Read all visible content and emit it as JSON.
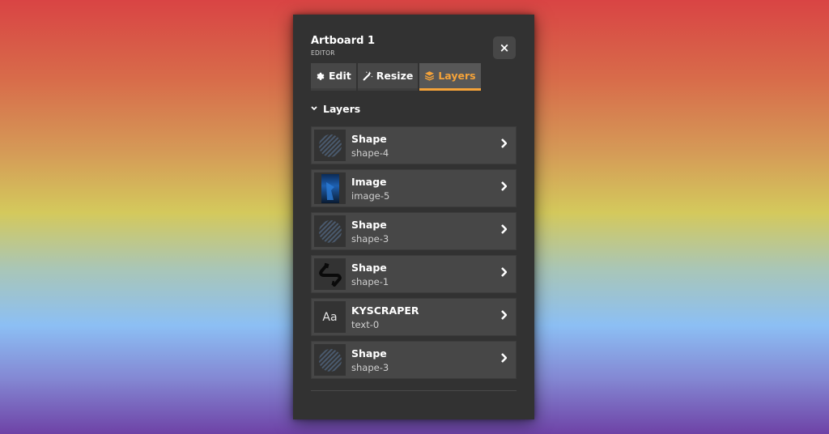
{
  "header": {
    "title": "Artboard 1",
    "subtitle": "EDITOR",
    "close_icon": "×"
  },
  "tabs": [
    {
      "label": "Edit",
      "icon": "gear-icon",
      "active": false
    },
    {
      "label": "Resize",
      "icon": "magic-wand-icon",
      "active": false
    },
    {
      "label": "Layers",
      "icon": "layers-icon",
      "active": true
    }
  ],
  "section": {
    "title": "Layers",
    "expanded": true
  },
  "layers": [
    {
      "title": "Shape",
      "id": "shape-4",
      "thumb": "hatched-circle"
    },
    {
      "title": "Image",
      "id": "image-5",
      "thumb": "image"
    },
    {
      "title": "Shape",
      "id": "shape-3",
      "thumb": "hatched-circle"
    },
    {
      "title": "Shape",
      "id": "shape-1",
      "thumb": "s-curve"
    },
    {
      "title": "KYSCRAPER",
      "id": "text-0",
      "thumb": "text",
      "thumb_text": "Aa"
    },
    {
      "title": "Shape",
      "id": "shape-3",
      "thumb": "hatched-circle"
    }
  ],
  "colors": {
    "accent": "#f5a339",
    "panel": "#323232",
    "row": "#474747"
  }
}
